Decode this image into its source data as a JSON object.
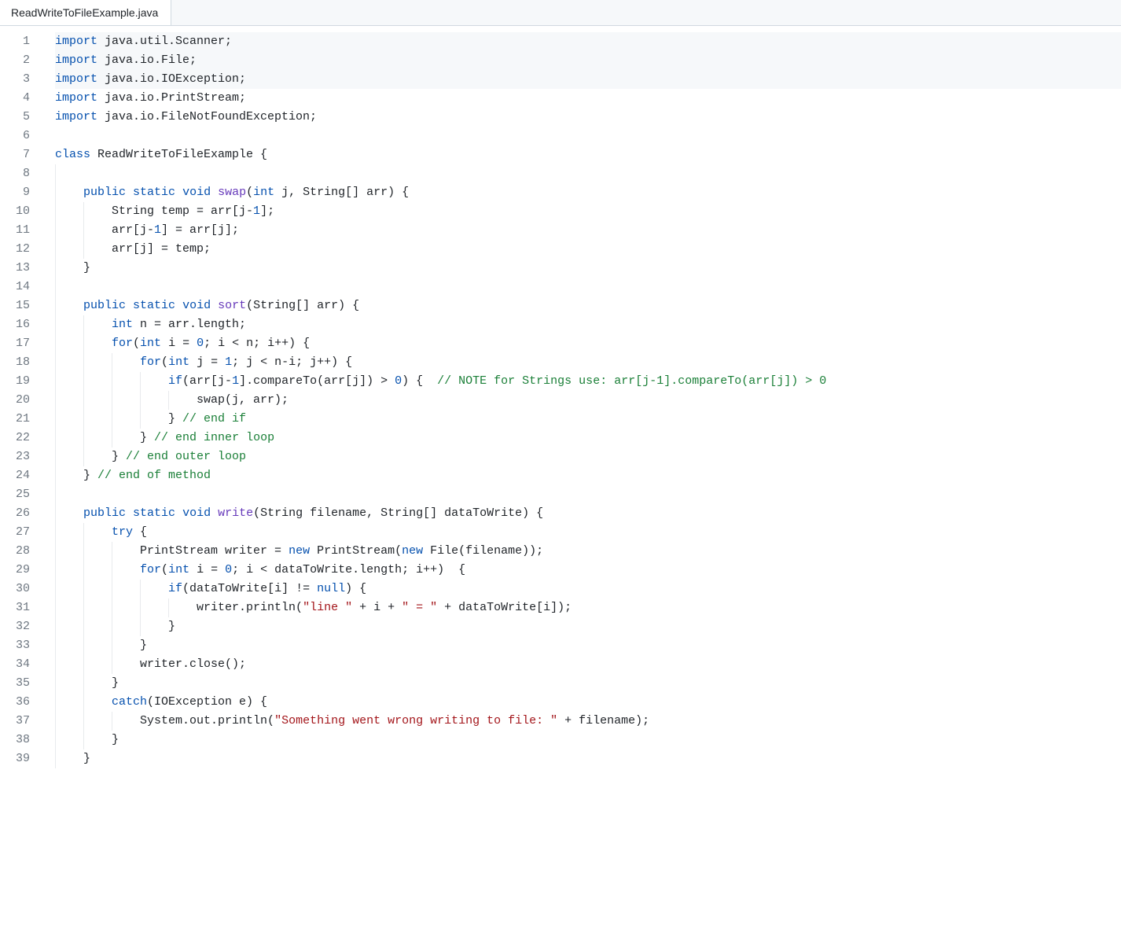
{
  "tab": {
    "filename": "ReadWriteToFileExample.java"
  },
  "code": {
    "line_count": 39,
    "highlighted_lines": [
      1,
      2,
      3
    ],
    "lines": [
      {
        "indent": 0,
        "tokens": [
          [
            "kw",
            "import"
          ],
          [
            "pl",
            " java.util.Scanner;"
          ]
        ]
      },
      {
        "indent": 0,
        "tokens": [
          [
            "kw",
            "import"
          ],
          [
            "pl",
            " java.io.File;"
          ]
        ]
      },
      {
        "indent": 0,
        "tokens": [
          [
            "kw",
            "import"
          ],
          [
            "pl",
            " java.io.IOException;"
          ]
        ]
      },
      {
        "indent": 0,
        "tokens": [
          [
            "kw",
            "import"
          ],
          [
            "pl",
            " java.io.PrintStream;"
          ]
        ]
      },
      {
        "indent": 0,
        "tokens": [
          [
            "kw",
            "import"
          ],
          [
            "pl",
            " java.io.FileNotFoundException;"
          ]
        ]
      },
      {
        "indent": 0,
        "tokens": []
      },
      {
        "indent": 0,
        "tokens": [
          [
            "kw",
            "class"
          ],
          [
            "pl",
            " ReadWriteToFileExample {"
          ]
        ]
      },
      {
        "indent": 1,
        "tokens": [
          [
            "pl",
            ""
          ]
        ]
      },
      {
        "indent": 1,
        "tokens": [
          [
            "kw",
            "public"
          ],
          [
            "pl",
            " "
          ],
          [
            "kw",
            "static"
          ],
          [
            "pl",
            " "
          ],
          [
            "kw",
            "void"
          ],
          [
            "pl",
            " "
          ],
          [
            "fn",
            "swap"
          ],
          [
            "pl",
            "("
          ],
          [
            "kw",
            "int"
          ],
          [
            "pl",
            " j, String[] arr) {"
          ]
        ]
      },
      {
        "indent": 2,
        "tokens": [
          [
            "pl",
            "String temp = arr[j-"
          ],
          [
            "nm",
            "1"
          ],
          [
            "pl",
            "];"
          ]
        ]
      },
      {
        "indent": 2,
        "tokens": [
          [
            "pl",
            "arr[j-"
          ],
          [
            "nm",
            "1"
          ],
          [
            "pl",
            "] = arr[j];"
          ]
        ]
      },
      {
        "indent": 2,
        "tokens": [
          [
            "pl",
            "arr[j] = temp;"
          ]
        ]
      },
      {
        "indent": 1,
        "tokens": [
          [
            "pl",
            "}"
          ]
        ]
      },
      {
        "indent": 1,
        "tokens": [
          [
            "pl",
            ""
          ]
        ]
      },
      {
        "indent": 1,
        "tokens": [
          [
            "kw",
            "public"
          ],
          [
            "pl",
            " "
          ],
          [
            "kw",
            "static"
          ],
          [
            "pl",
            " "
          ],
          [
            "kw",
            "void"
          ],
          [
            "pl",
            " "
          ],
          [
            "fn",
            "sort"
          ],
          [
            "pl",
            "(String[] arr) {"
          ]
        ]
      },
      {
        "indent": 2,
        "tokens": [
          [
            "kw",
            "int"
          ],
          [
            "pl",
            " n = arr.length;"
          ]
        ]
      },
      {
        "indent": 2,
        "tokens": [
          [
            "kw",
            "for"
          ],
          [
            "pl",
            "("
          ],
          [
            "kw",
            "int"
          ],
          [
            "pl",
            " i = "
          ],
          [
            "nm",
            "0"
          ],
          [
            "pl",
            "; i < n; i++) {"
          ]
        ]
      },
      {
        "indent": 3,
        "tokens": [
          [
            "kw",
            "for"
          ],
          [
            "pl",
            "("
          ],
          [
            "kw",
            "int"
          ],
          [
            "pl",
            " j = "
          ],
          [
            "nm",
            "1"
          ],
          [
            "pl",
            "; j < n-i; j++) {"
          ]
        ]
      },
      {
        "indent": 4,
        "tokens": [
          [
            "kw",
            "if"
          ],
          [
            "pl",
            "(arr[j-"
          ],
          [
            "nm",
            "1"
          ],
          [
            "pl",
            "].compareTo(arr[j]) > "
          ],
          [
            "nm",
            "0"
          ],
          [
            "pl",
            ") {  "
          ],
          [
            "cm",
            "// NOTE for Strings use: arr[j-1].compareTo(arr[j]) > 0"
          ]
        ]
      },
      {
        "indent": 5,
        "tokens": [
          [
            "pl",
            "swap(j, arr);"
          ]
        ]
      },
      {
        "indent": 4,
        "tokens": [
          [
            "pl",
            "} "
          ],
          [
            "cm",
            "// end if"
          ]
        ]
      },
      {
        "indent": 3,
        "tokens": [
          [
            "pl",
            "} "
          ],
          [
            "cm",
            "// end inner loop"
          ]
        ]
      },
      {
        "indent": 2,
        "tokens": [
          [
            "pl",
            "} "
          ],
          [
            "cm",
            "// end outer loop"
          ]
        ]
      },
      {
        "indent": 1,
        "tokens": [
          [
            "pl",
            "} "
          ],
          [
            "cm",
            "// end of method"
          ]
        ]
      },
      {
        "indent": 1,
        "tokens": [
          [
            "pl",
            ""
          ]
        ]
      },
      {
        "indent": 1,
        "tokens": [
          [
            "kw",
            "public"
          ],
          [
            "pl",
            " "
          ],
          [
            "kw",
            "static"
          ],
          [
            "pl",
            " "
          ],
          [
            "kw",
            "void"
          ],
          [
            "pl",
            " "
          ],
          [
            "fn",
            "write"
          ],
          [
            "pl",
            "(String filename, String[] dataToWrite) {"
          ]
        ]
      },
      {
        "indent": 2,
        "tokens": [
          [
            "kw",
            "try"
          ],
          [
            "pl",
            " {"
          ]
        ]
      },
      {
        "indent": 3,
        "tokens": [
          [
            "pl",
            "PrintStream writer = "
          ],
          [
            "kw",
            "new"
          ],
          [
            "pl",
            " PrintStream("
          ],
          [
            "kw",
            "new"
          ],
          [
            "pl",
            " File(filename));"
          ]
        ]
      },
      {
        "indent": 3,
        "tokens": [
          [
            "kw",
            "for"
          ],
          [
            "pl",
            "("
          ],
          [
            "kw",
            "int"
          ],
          [
            "pl",
            " i = "
          ],
          [
            "nm",
            "0"
          ],
          [
            "pl",
            "; i < dataToWrite.length; i++)  {"
          ]
        ]
      },
      {
        "indent": 4,
        "tokens": [
          [
            "kw",
            "if"
          ],
          [
            "pl",
            "(dataToWrite[i] != "
          ],
          [
            "kw",
            "null"
          ],
          [
            "pl",
            ") {"
          ]
        ]
      },
      {
        "indent": 5,
        "tokens": [
          [
            "pl",
            "writer.println("
          ],
          [
            "st",
            "\"line \""
          ],
          [
            "pl",
            " + i + "
          ],
          [
            "st",
            "\" = \""
          ],
          [
            "pl",
            " + dataToWrite[i]);"
          ]
        ]
      },
      {
        "indent": 4,
        "tokens": [
          [
            "pl",
            "}"
          ]
        ]
      },
      {
        "indent": 3,
        "tokens": [
          [
            "pl",
            "}"
          ]
        ]
      },
      {
        "indent": 3,
        "tokens": [
          [
            "pl",
            "writer.close();"
          ]
        ]
      },
      {
        "indent": 2,
        "tokens": [
          [
            "pl",
            "}"
          ]
        ]
      },
      {
        "indent": 2,
        "tokens": [
          [
            "kw",
            "catch"
          ],
          [
            "pl",
            "(IOException e) {"
          ]
        ]
      },
      {
        "indent": 3,
        "tokens": [
          [
            "pl",
            "System.out.println("
          ],
          [
            "st",
            "\"Something went wrong writing to file: \""
          ],
          [
            "pl",
            " + filename);"
          ]
        ]
      },
      {
        "indent": 2,
        "tokens": [
          [
            "pl",
            "}"
          ]
        ]
      },
      {
        "indent": 1,
        "tokens": [
          [
            "pl",
            "}"
          ]
        ]
      }
    ]
  }
}
